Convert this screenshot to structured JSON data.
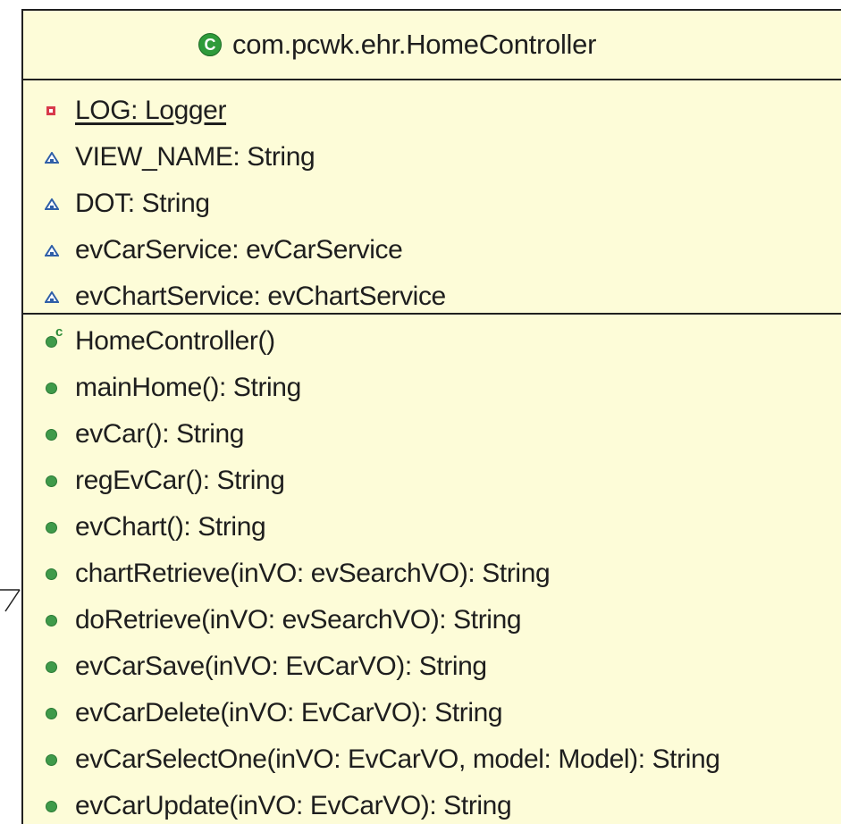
{
  "class": {
    "icon_glyph": "C",
    "name": "com.pcwk.ehr.HomeController"
  },
  "attributes": [
    {
      "visibility": "private",
      "icon": "private-field-icon",
      "label": "LOG: Logger",
      "static": true
    },
    {
      "visibility": "default",
      "icon": "default-field-icon",
      "label": "VIEW_NAME: String",
      "static": false
    },
    {
      "visibility": "default",
      "icon": "default-field-icon",
      "label": "DOT: String",
      "static": false
    },
    {
      "visibility": "default",
      "icon": "default-field-icon",
      "label": "evCarService: evCarService",
      "static": false
    },
    {
      "visibility": "default",
      "icon": "default-field-icon",
      "label": "evChartService: evChartService",
      "static": false
    }
  ],
  "operations": [
    {
      "visibility": "public",
      "icon": "constructor-icon",
      "label": "HomeController()",
      "constructor": true
    },
    {
      "visibility": "public",
      "icon": "public-method-icon",
      "label": "mainHome(): String"
    },
    {
      "visibility": "public",
      "icon": "public-method-icon",
      "label": "evCar(): String"
    },
    {
      "visibility": "public",
      "icon": "public-method-icon",
      "label": "regEvCar(): String"
    },
    {
      "visibility": "public",
      "icon": "public-method-icon",
      "label": "evChart(): String"
    },
    {
      "visibility": "public",
      "icon": "public-method-icon",
      "label": "chartRetrieve(inVO: evSearchVO): String"
    },
    {
      "visibility": "public",
      "icon": "public-method-icon",
      "label": "doRetrieve(inVO: evSearchVO): String"
    },
    {
      "visibility": "public",
      "icon": "public-method-icon",
      "label": "evCarSave(inVO: EvCarVO): String"
    },
    {
      "visibility": "public",
      "icon": "public-method-icon",
      "label": "evCarDelete(inVO: EvCarVO): String"
    },
    {
      "visibility": "public",
      "icon": "public-method-icon",
      "label": "evCarSelectOne(inVO: EvCarVO, model: Model): String"
    },
    {
      "visibility": "public",
      "icon": "public-method-icon",
      "label": "evCarUpdate(inVO: EvCarVO): String"
    }
  ],
  "colors": {
    "box_fill": "#fdfcd8",
    "border": "#202020",
    "private": "#d83a4b",
    "default": "#2f5fa8",
    "public": "#3f9a4a"
  }
}
